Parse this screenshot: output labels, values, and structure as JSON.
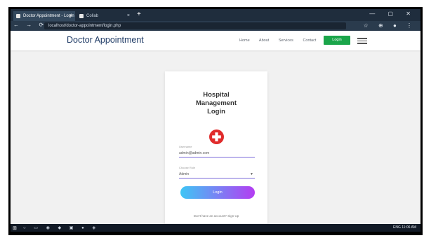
{
  "browser": {
    "tabs": [
      {
        "label": "Doctor Appointment - Login",
        "active": true
      },
      {
        "label": "Collab",
        "active": false
      }
    ],
    "new_tab_symbol": "+",
    "window_controls": "— ▢ ✕",
    "nav_symbols": "← → ⟳",
    "url": "localhost/doctor-appointment/login.php",
    "extension_symbols": "☆ ⊕ ● ⋮"
  },
  "site": {
    "brand": "Doctor Appointment",
    "menu": [
      "Home",
      "About",
      "Services",
      "Contact"
    ],
    "login_button": "Login"
  },
  "card": {
    "title_lines": [
      "Hospital",
      "Management",
      "Login"
    ],
    "username_label": "Username",
    "username_value": "admin@admin.com",
    "role_label": "Choose Role",
    "role_value": "Admin",
    "submit_label": "Login",
    "footer_text": "Don't have an account? Sign Up"
  },
  "taskbar": {
    "start_symbol": "⊞",
    "icons": "○ ▭ ◉ ◆ ▣ ● ◈",
    "tray_text": "ENG 11:06 AM"
  },
  "colors": {
    "brand": "#1f3b66",
    "login_green": "#1aa54a",
    "gradient_start": "#3ec6f5",
    "gradient_end": "#b43df2",
    "medical_red": "#e02b2b"
  }
}
